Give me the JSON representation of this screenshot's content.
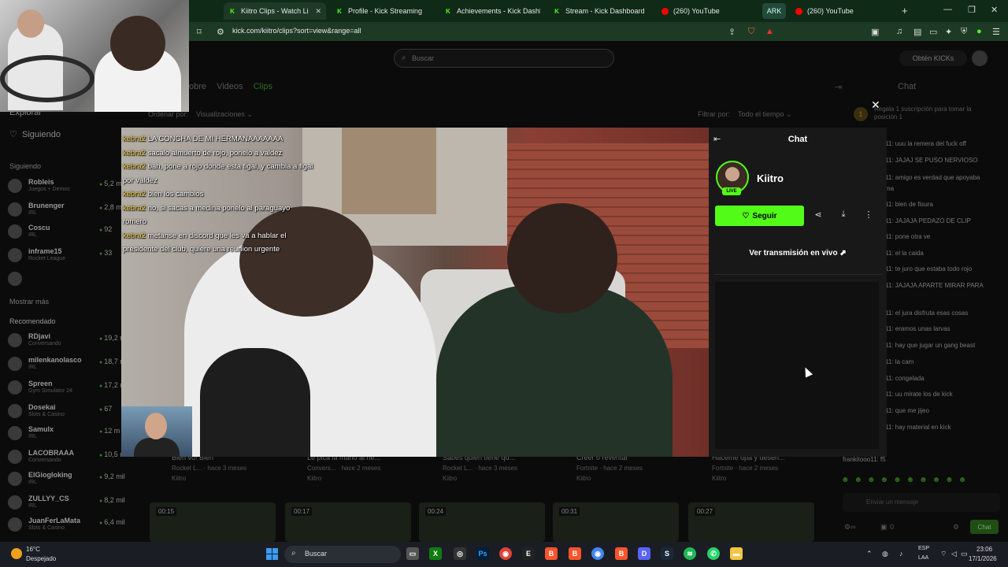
{
  "browser": {
    "tabs": [
      {
        "label": "Kiitro Clips - Watch Li",
        "icon": "kick-icon",
        "active": true
      },
      {
        "label": "Profile - Kick Streaming",
        "icon": "kick-icon"
      },
      {
        "label": "Achievements - Kick Dashbo",
        "icon": "kick-icon"
      },
      {
        "label": "Stream - Kick Dashboard",
        "icon": "kick-icon"
      },
      {
        "label": "(260) YouTube",
        "icon": "youtube-icon"
      },
      {
        "label": "(260) YouTube",
        "icon": "youtube-icon"
      }
    ],
    "tab_group_label": "ARK",
    "url": "kick.com/kiitro/clips?sort=view&range=all"
  },
  "page": {
    "search_placeholder": "Buscar",
    "get_kicks_label": "Obtén KICKs",
    "subtabs": [
      "obre",
      "Videos",
      "Clips"
    ],
    "sort_label": "Ordenar por:",
    "sort_value": "Visualizaciones",
    "filter_label": "Filtrar por:",
    "filter_value": "Todo el tiempo",
    "chat_title": "Chat"
  },
  "sidebar": {
    "explore": "Explorar",
    "following_link": "Siguiendo",
    "following_header": "Siguiendo",
    "following": [
      {
        "name": "Robleis",
        "category": "Juegos + Demos",
        "viewers": "5,2 m"
      },
      {
        "name": "Brunenger",
        "category": "IRL",
        "viewers": "2,8 m"
      },
      {
        "name": "Coscu",
        "category": "IRL",
        "viewers": "92"
      },
      {
        "name": "inframe15",
        "category": "Rocket League",
        "viewers": "33"
      },
      {
        "name": "",
        "category": "",
        "viewers": ""
      }
    ],
    "show_more": "Mostrar más",
    "recommended_header": "Recomendado",
    "recommended": [
      {
        "name": "RDjavi",
        "category": "Conversando",
        "viewers": "19,2 m"
      },
      {
        "name": "milenkanolasco",
        "category": "IRL",
        "viewers": "18,7 m"
      },
      {
        "name": "Spreen",
        "category": "Gym Simulator 24",
        "viewers": "17,2 m"
      },
      {
        "name": "Dosekai",
        "category": "Slots & Casino",
        "viewers": "67"
      },
      {
        "name": "Samulx",
        "category": "IRL",
        "viewers": "12 m"
      },
      {
        "name": "LACOBRAAA",
        "category": "Conversando",
        "viewers": "10,5 m"
      },
      {
        "name": "ElGiogloking",
        "category": "IRL",
        "viewers": "9,2 mil"
      },
      {
        "name": "ZULLYY_CS",
        "category": "IRL",
        "viewers": "8,2 mil"
      },
      {
        "name": "JuanFerLaMata",
        "category": "Slots & Casino",
        "viewers": "6,4 mil"
      }
    ]
  },
  "bg_chat": {
    "sub_banner": "Regala 1 suscripción para tomar la posición 1",
    "messages": [
      "11: uuu la remera del fuck off",
      "11: JAJAJ SE PUSO NERVIOSO",
      "11: amigo es verdad que apoyaba",
      "ma",
      "11: bien de fisura",
      "11: JAJAJA PEDAZO DE CLIP",
      "11: pone otra ve",
      "11: el la caida",
      "11: te juro que estaba todo rojo",
      "11: JAJAJA APARTE MIRAR PARA",
      "",
      "11: el jura disfruta esas cosas",
      "11: eramos unas larvas",
      "11: hay que jugar un gang beast",
      "11: la cam",
      "11: congelada",
      "11: uu mirate los de kick",
      "11: que me jijeo",
      "11: hay material en kick",
      "",
      "frankitooo11: f5"
    ],
    "input_placeholder": "Enviar un mensaje",
    "send_label": "Chat",
    "points": "0"
  },
  "clips_row": [
    {
      "title": "Bien vo! Bien",
      "game": "Rocket L...",
      "age": "hace 3 meses",
      "channel": "Kiitro",
      "duration": "00:15"
    },
    {
      "title": "Le pica la mano al ne...",
      "game": "Convers...",
      "age": "hace 2 meses",
      "channel": "Kiitro",
      "duration": "00:17"
    },
    {
      "title": "Sabes quien tiene qu...",
      "game": "Rocket L...",
      "age": "hace 3 meses",
      "channel": "Kiitro",
      "duration": "00:24"
    },
    {
      "title": "Creer o reventar",
      "game": "Fortnite",
      "age": "hace 2 meses",
      "channel": "Kiitro",
      "duration": "00:31"
    },
    {
      "title": "Haceme upa y desen...",
      "game": "Fortnite",
      "age": "hace 2 meses",
      "channel": "Kiitro",
      "duration": "00:27"
    }
  ],
  "overlay_chat": [
    {
      "user": "kebra2",
      "text": " LA CONCHA DE MI HERMANAAAAAAA"
    },
    {
      "user": "kebra2",
      "text": " sacalo almuerto de rojo, ponelo a valdez"
    },
    {
      "user": "kebra2",
      "text": " bah, pone a rojo donde esta figal, y cambia a figal"
    },
    {
      "user": "",
      "text": "por valdez"
    },
    {
      "user": "kebra2",
      "text": " bien los cambios"
    },
    {
      "user": "kebra2",
      "text": " no, si sacas a medina ponelo al paraguayo"
    },
    {
      "user": "",
      "text": "romero"
    },
    {
      "user": "kebra2",
      "text": " metanse en discord que les va a hablar el"
    },
    {
      "user": "",
      "text": "presidente del club, quiere una reunion urgente"
    }
  ],
  "modal": {
    "panel_title": "Chat",
    "channel_name": "Kiitro",
    "live_badge": "LIVE",
    "follow_label": "Seguir",
    "watch_live_label": "Ver transmisión en vivo"
  },
  "taskbar": {
    "temp": "16°C",
    "weather": "Despejado",
    "search_placeholder": "Buscar",
    "lang1": "ESP",
    "lang2": "LAA",
    "time": "23:06",
    "date": "17/1/2026"
  },
  "colors": {
    "kick_green": "#53fc18",
    "panel_bg": "#181818"
  }
}
